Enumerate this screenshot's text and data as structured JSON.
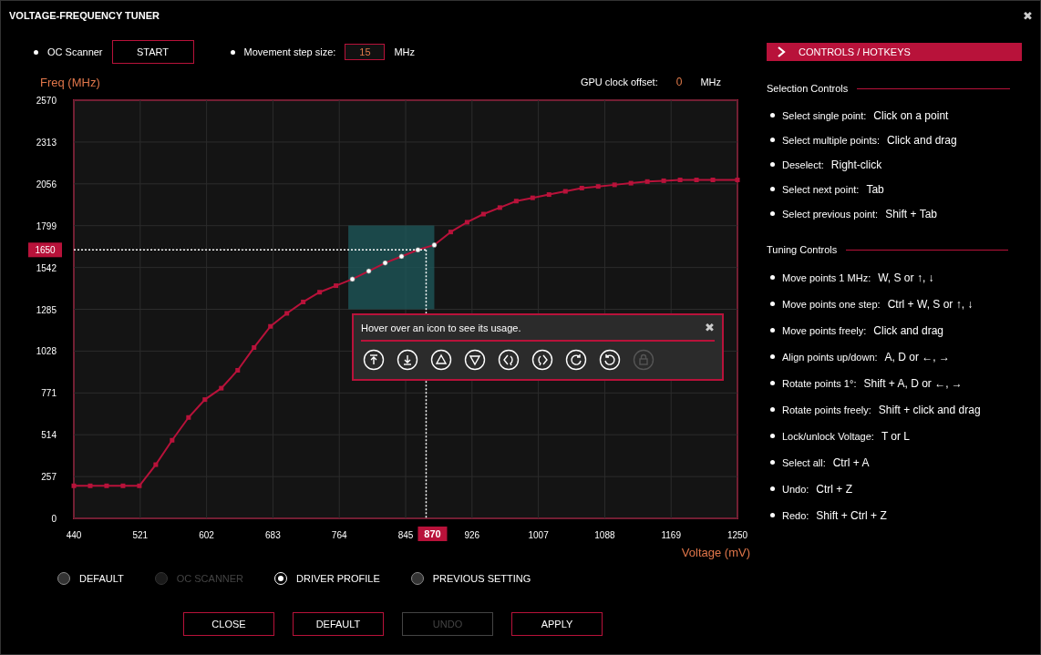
{
  "window": {
    "title": "VOLTAGE-FREQUENCY TUNER",
    "close": "✖"
  },
  "toolbar": {
    "oc_scanner_label": "OC Scanner",
    "start_button": "START",
    "step_label": "Movement step size:",
    "step_value": "15",
    "step_unit": "MHz"
  },
  "offset": {
    "label": "GPU clock offset:",
    "value": "0",
    "unit": "MHz"
  },
  "chart": {
    "chart_data": {
      "type": "line",
      "xlabel": "Voltage (mV)",
      "ylabel": "Freq (MHz)",
      "x": [
        440,
        460,
        480,
        500,
        520,
        540,
        560,
        580,
        600,
        620,
        640,
        660,
        680,
        700,
        720,
        740,
        760,
        780,
        800,
        820,
        840,
        860,
        880,
        900,
        920,
        940,
        960,
        980,
        1000,
        1020,
        1040,
        1060,
        1080,
        1100,
        1120,
        1140,
        1160,
        1180,
        1200,
        1220,
        1250
      ],
      "series": [
        {
          "color": "#b8123a",
          "marker": "square",
          "values": [
            200,
            200,
            200,
            200,
            200,
            330,
            480,
            620,
            730,
            800,
            910,
            1050,
            1180,
            1260,
            1330,
            1390,
            1430,
            1470,
            1520,
            1570,
            1610,
            1650,
            1680,
            1760,
            1820,
            1870,
            1910,
            1950,
            1970,
            1990,
            2010,
            2030,
            2040,
            2050,
            2060,
            2070,
            2075,
            2080,
            2080,
            2080,
            2080
          ]
        }
      ],
      "xlim": [
        440,
        1250
      ],
      "ylim": [
        0,
        2570
      ],
      "grid": true,
      "xticks": [
        440,
        521,
        602,
        683,
        764,
        845,
        926,
        1007,
        1088,
        1169,
        1250
      ],
      "yticks": [
        0,
        257,
        514,
        771,
        1028,
        1285,
        1542,
        1799,
        2056,
        2313,
        2570
      ],
      "bands": [
        {
          "axis": "x",
          "from": 775,
          "to": 880
        }
      ],
      "ref_lines": [
        {
          "axis": "y",
          "value": 1650,
          "label": "1650"
        },
        {
          "axis": "x",
          "value": 870,
          "label": "870"
        }
      ]
    }
  },
  "popup": {
    "text": "Hover over an icon to see its usage.",
    "close": "✖",
    "icons": [
      {
        "kind": "top",
        "disabled": false
      },
      {
        "kind": "bottom",
        "disabled": false
      },
      {
        "kind": "up",
        "disabled": false
      },
      {
        "kind": "down",
        "disabled": false
      },
      {
        "kind": "rotate-left",
        "disabled": false
      },
      {
        "kind": "rotate-right",
        "disabled": false
      },
      {
        "kind": "redo",
        "disabled": false
      },
      {
        "kind": "undo",
        "disabled": false
      },
      {
        "kind": "lock",
        "disabled": true
      }
    ]
  },
  "profiles": [
    {
      "label": "DEFAULT",
      "selected": false,
      "disabled": false
    },
    {
      "label": "OC SCANNER",
      "selected": false,
      "disabled": true
    },
    {
      "label": "DRIVER PROFILE",
      "selected": true,
      "disabled": false
    },
    {
      "label": "PREVIOUS SETTING",
      "selected": false,
      "disabled": false
    }
  ],
  "buttons": [
    {
      "label": "CLOSE",
      "disabled": false
    },
    {
      "label": "DEFAULT",
      "disabled": false
    },
    {
      "label": "UNDO",
      "disabled": true
    },
    {
      "label": "APPLY",
      "disabled": false
    }
  ],
  "sidebar": {
    "header": "CONTROLS / HOTKEYS",
    "sections": [
      {
        "title": "Selection Controls",
        "items": [
          {
            "label": "Select single point:",
            "keys": "Click on a point"
          },
          {
            "label": "Select multiple points:",
            "keys": "Click and drag"
          },
          {
            "label": "Deselect:",
            "keys": "Right-click"
          },
          {
            "label": "Select next point:",
            "keys": "Tab"
          },
          {
            "label": "Select previous point:",
            "keys": "Shift + Tab"
          }
        ]
      },
      {
        "title": "Tuning Controls",
        "items": [
          {
            "label": "Move points 1 MHz:",
            "keys": "W, S or ↑, ↓"
          },
          {
            "label": "Move points one step:",
            "keys": "Ctrl + W, S or ↑, ↓"
          },
          {
            "label": "Move points freely:",
            "keys": "Click and drag"
          },
          {
            "label": "Align points up/down:",
            "keys": "A, D or ←, →"
          },
          {
            "label": "Rotate points 1°:",
            "keys": "Shift + A, D or ←, →"
          },
          {
            "label": "Rotate points freely:",
            "keys": "Shift + click and drag"
          },
          {
            "label": "Lock/unlock Voltage:",
            "keys": "T or L"
          },
          {
            "label": "Select all:",
            "keys": "Ctrl + A"
          },
          {
            "label": "Undo:",
            "keys": "Ctrl + Z"
          },
          {
            "label": "Redo:",
            "keys": "Shift + Ctrl + Z"
          }
        ]
      }
    ]
  }
}
